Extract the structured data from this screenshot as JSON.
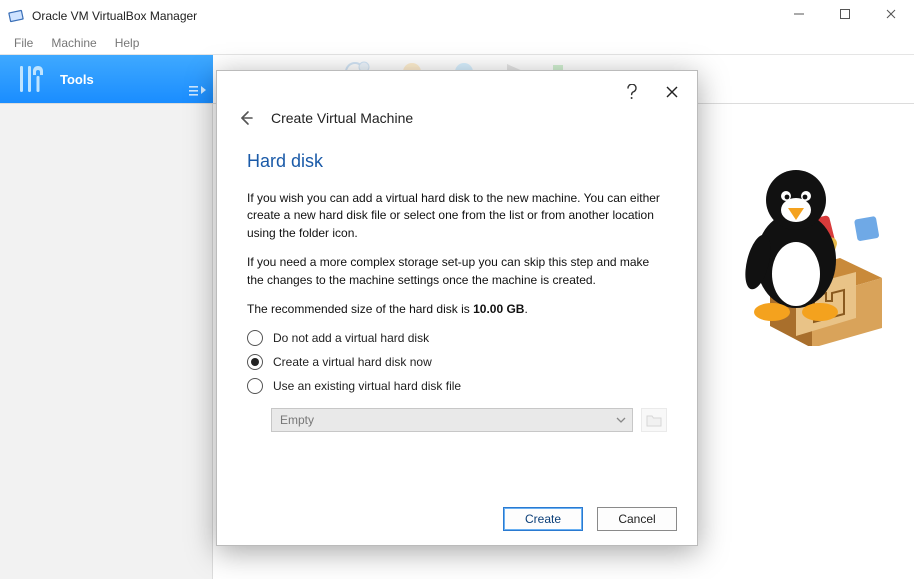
{
  "window": {
    "title": "Oracle VM VirtualBox Manager"
  },
  "menubar": [
    "File",
    "Machine",
    "Help"
  ],
  "tools_pane": {
    "label": "Tools"
  },
  "dialog": {
    "breadcrumb": "Create Virtual Machine",
    "heading": "Hard disk",
    "para1": "If you wish you can add a virtual hard disk to the new machine. You can either create a new hard disk file or select one from the list or from another location using the folder icon.",
    "para2": "If you need a more complex storage set-up you can skip this step and make the changes to the machine settings once the machine is created.",
    "rec_prefix": "The recommended size of the hard disk is ",
    "rec_size": "10.00 GB",
    "rec_suffix": ".",
    "options": [
      {
        "label": "Do not add a virtual hard disk",
        "checked": false
      },
      {
        "label": "Create a virtual hard disk now",
        "checked": true
      },
      {
        "label": "Use an existing virtual hard disk file",
        "checked": false
      }
    ],
    "combo_value": "Empty",
    "buttons": {
      "primary": "Create",
      "cancel": "Cancel"
    }
  }
}
